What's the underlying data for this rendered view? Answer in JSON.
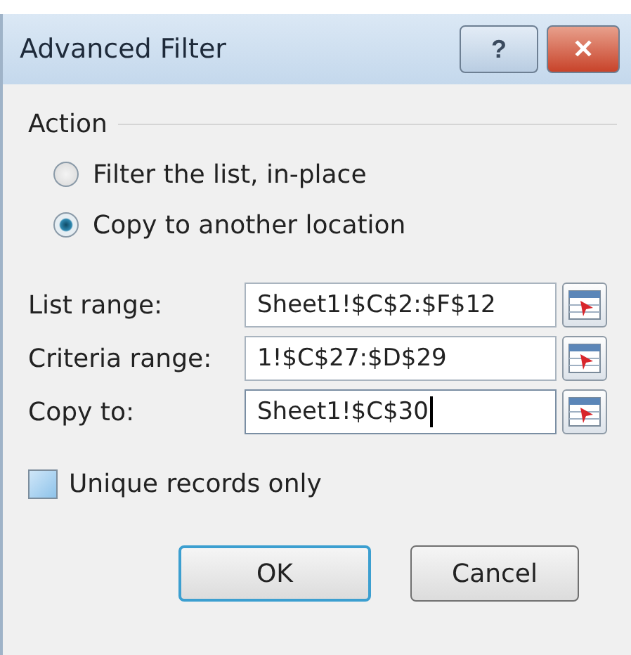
{
  "window": {
    "title": "Advanced Filter",
    "buttons": [
      {
        "kind": "help",
        "label": "?"
      },
      {
        "kind": "close",
        "label": "✕"
      }
    ]
  },
  "action": {
    "label": "Action",
    "options": [
      {
        "label": "Filter the list, in-place",
        "selected": false
      },
      {
        "label": "Copy to another location",
        "selected": true
      }
    ]
  },
  "fields": [
    {
      "label": "List range:",
      "value": "Sheet1!$C$2:$F$12",
      "focused": false
    },
    {
      "label": "Criteria range:",
      "value": "1!$C$27:$D$29",
      "focused": false
    },
    {
      "label": "Copy to:",
      "value": "Sheet1!$C$30",
      "focused": true
    }
  ],
  "unique": {
    "label": "Unique records only",
    "checked": false
  },
  "buttons": [
    {
      "label": "OK",
      "default": true
    },
    {
      "label": "Cancel",
      "default": false
    }
  ]
}
